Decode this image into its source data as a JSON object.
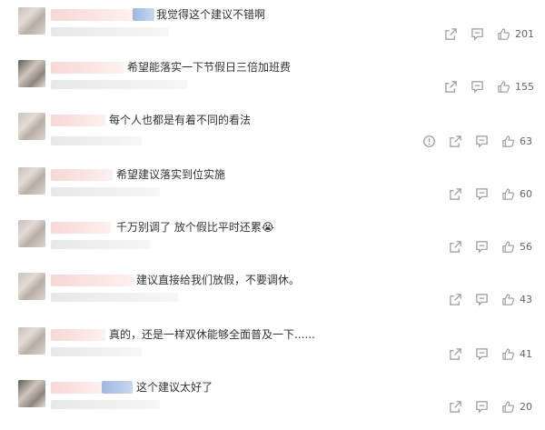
{
  "comments": [
    {
      "text": "我觉得这个建议不错啊",
      "likes": "201"
    },
    {
      "text": "希望能落实一下节假日三倍加班费",
      "likes": "155"
    },
    {
      "text": "每个人也都是有着不同的看法",
      "likes": "63"
    },
    {
      "text": "希望建议落实到位实施",
      "likes": "60"
    },
    {
      "text": "千万别调了 放个假比平时还累😭",
      "likes": "56"
    },
    {
      "text": "建议直接给我们放假，不要调休。",
      "likes": "43"
    },
    {
      "text": "真的，还是一样双休能够全面普及一下......",
      "likes": "41"
    },
    {
      "text": "这个建议太好了",
      "likes": "20"
    }
  ],
  "icons": {
    "forward": "forward-icon",
    "reply": "comment-icon",
    "like": "thumbs-up-icon",
    "report": "report-icon"
  }
}
